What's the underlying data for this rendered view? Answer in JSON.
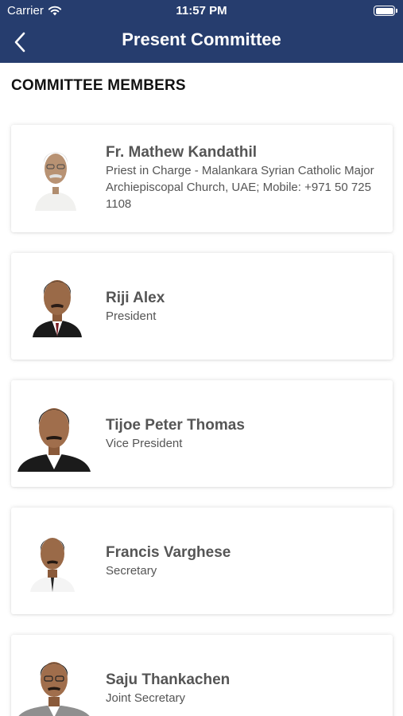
{
  "status_bar": {
    "carrier": "Carrier",
    "time": "11:57 PM"
  },
  "nav": {
    "title": "Present Committee"
  },
  "section": {
    "title": "COMMITTEE MEMBERS"
  },
  "members": [
    {
      "name": "Fr. Mathew Kandathil",
      "role": "Priest in Charge - Malankara Syrian Catholic Major Archiepiscopal Church, UAE;   Mobile: +971 50 725 1108"
    },
    {
      "name": "Riji Alex",
      "role": "President"
    },
    {
      "name": "Tijoe Peter Thomas",
      "role": "Vice President"
    },
    {
      "name": "Francis Varghese",
      "role": "Secretary"
    },
    {
      "name": "Saju Thankachen",
      "role": "Joint Secretary"
    }
  ],
  "colors": {
    "nav_background": "#263d6e",
    "name_text": "#555555",
    "card_background": "#ffffff"
  }
}
